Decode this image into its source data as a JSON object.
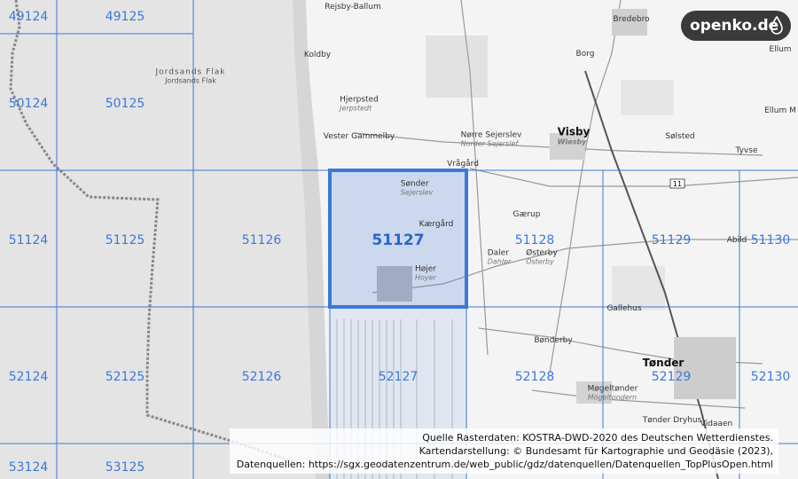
{
  "logo": {
    "text": "openko.de"
  },
  "grid": {
    "cells": [
      {
        "id": "49124",
        "label": "49124"
      },
      {
        "id": "49125",
        "label": "49125"
      },
      {
        "id": "50124",
        "label": "50124"
      },
      {
        "id": "50125",
        "label": "50125"
      },
      {
        "id": "51124",
        "label": "51124"
      },
      {
        "id": "51125",
        "label": "51125"
      },
      {
        "id": "51126",
        "label": "51126"
      },
      {
        "id": "51127",
        "label": "51127",
        "selected": true
      },
      {
        "id": "51128",
        "label": "51128"
      },
      {
        "id": "51129",
        "label": "51129"
      },
      {
        "id": "51130",
        "label": "51130"
      },
      {
        "id": "52124",
        "label": "52124"
      },
      {
        "id": "52125",
        "label": "52125"
      },
      {
        "id": "52126",
        "label": "52126"
      },
      {
        "id": "52127",
        "label": "52127"
      },
      {
        "id": "52128",
        "label": "52128"
      },
      {
        "id": "52129",
        "label": "52129"
      },
      {
        "id": "52130",
        "label": "52130"
      },
      {
        "id": "53124",
        "label": "53124"
      },
      {
        "id": "53125",
        "label": "53125"
      }
    ]
  },
  "places": {
    "rejsby": "Rejsby-Ballum",
    "bredebro": "Bredebro",
    "koldby": "Koldby",
    "borg": "Borg",
    "ellum": "Ellum",
    "hjerpsted": "Hjerpsted",
    "hjerpsted_de": "Jerpstedt",
    "ellum_mark": "Ellum M",
    "vester": "Vester Gammelby",
    "norre": "Nørre Sejerslev",
    "norre_de": "Norder Sejerslef",
    "visby": "Visby",
    "visby_de": "Wiesby",
    "solsted": "Sølsted",
    "tyvse": "Tyvse",
    "vragard": "Vrågård",
    "sonder": "Sønder",
    "sonder2": "Sejerslev",
    "kaergard": "Kærgård",
    "gaerup": "Gærup",
    "abild": "Abild",
    "daler": "Daler",
    "daler_de": "Dahler",
    "osterby": "Østerby",
    "osterby_de": "Osterby",
    "hojer": "Højer",
    "hojer_de": "Hoyer",
    "gallehus": "Gallehus",
    "bonderby": "Bønderby",
    "tonder": "Tønder",
    "mogeltonder": "Møgeltønder",
    "mogeltonder_de": "Mögeltondern",
    "tonder_dryhus": "Tønder Dryhus",
    "vidaaen": "Vidaaen"
  },
  "sea": {
    "label": "Jordsands Flak",
    "label_de": "Jordsands Flak"
  },
  "road_number": "11",
  "attribution": {
    "line1": "Quelle Rasterdaten: KOSTRA-DWD-2020 des Deutschen Wetterdienstes.",
    "line2": "Kartendarstellung: © Bundesamt für Kartographie und Geodäsie (2023),",
    "line3": "Datenquellen: https://sgx.geodatenzentrum.de/web_public/gdz/datenquellen/Datenquellen_TopPlusOpen.html"
  },
  "colors": {
    "grid": "#3c78d8",
    "selected_fill": "#c9d7f2",
    "sea": "#e3e3e3",
    "land": "#f5f5f5"
  }
}
